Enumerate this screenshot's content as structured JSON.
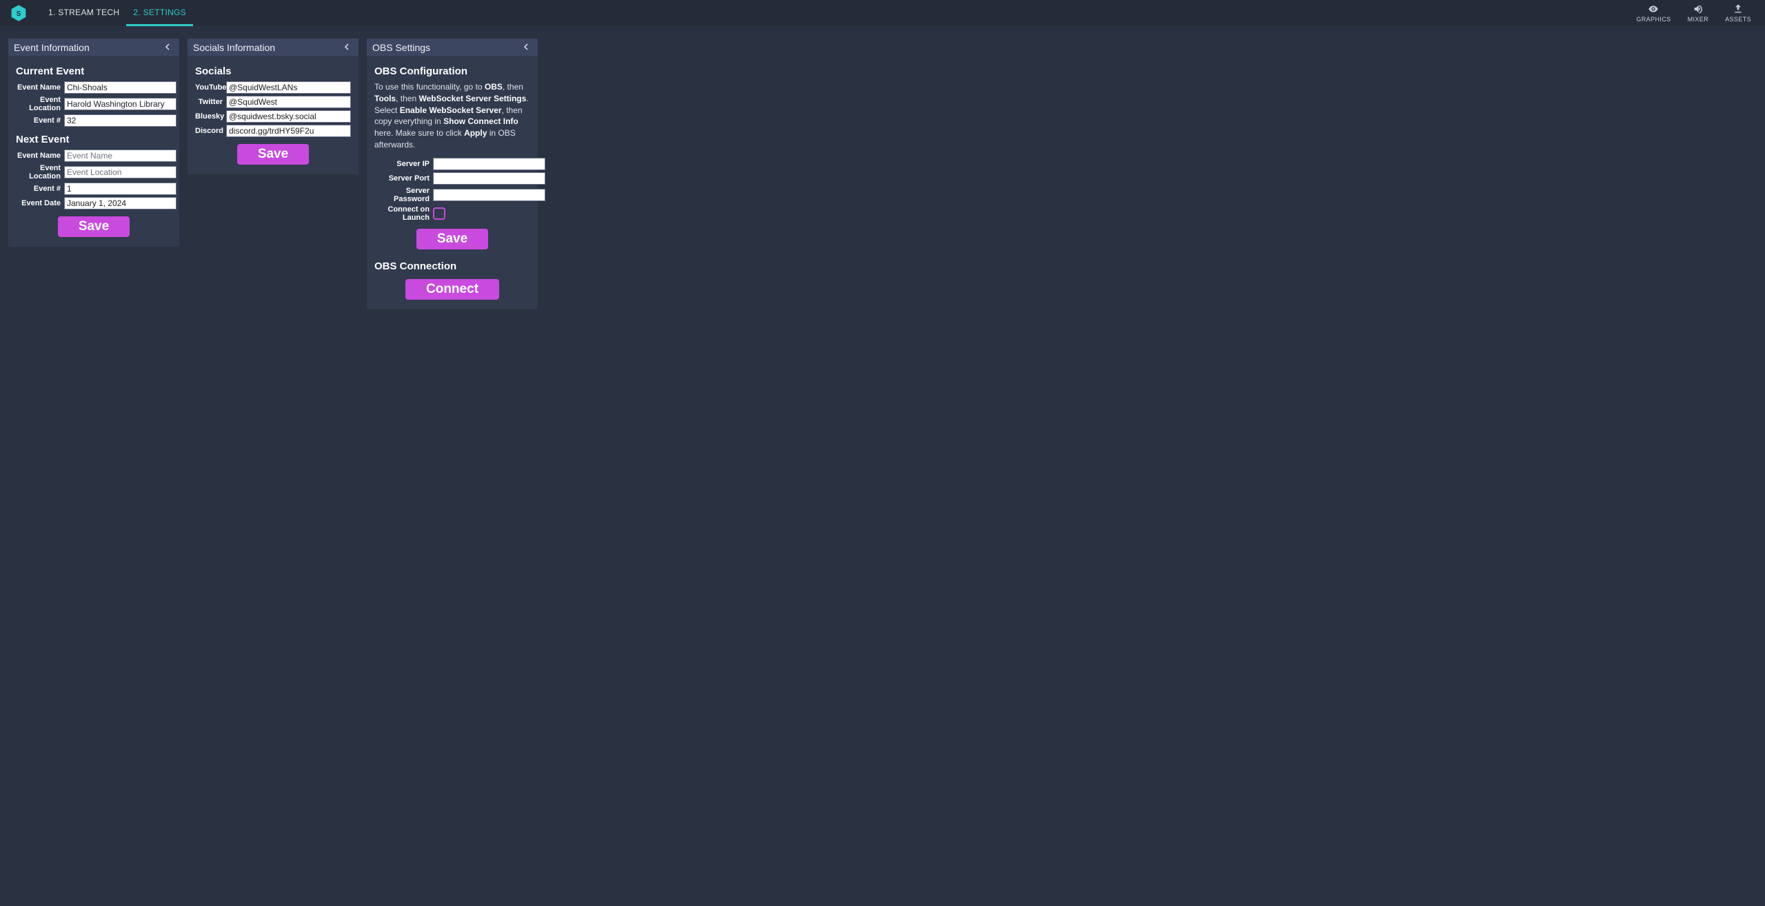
{
  "header": {
    "tabs": [
      {
        "label": "1. STREAM TECH",
        "active": false
      },
      {
        "label": "2. SETTINGS",
        "active": true
      }
    ],
    "right": {
      "graphics": "GRAPHICS",
      "mixer": "MIXER",
      "assets": "ASSETS"
    }
  },
  "panels": {
    "event": {
      "title": "Event Information",
      "current_heading": "Current Event",
      "next_heading": "Next Event",
      "labels": {
        "event_name": "Event Name",
        "event_location": "Event Location",
        "event_number": "Event #",
        "event_date": "Event Date"
      },
      "current": {
        "name": "Chi-Shoals",
        "location": "Harold Washington Library",
        "number": "32"
      },
      "next": {
        "name": "",
        "location": "",
        "number": "1",
        "date": "January 1, 2024",
        "name_placeholder": "Event Name",
        "location_placeholder": "Event Location"
      },
      "save_label": "Save"
    },
    "socials": {
      "title": "Socials Information",
      "heading": "Socials",
      "labels": {
        "youtube": "YouTube",
        "twitter": "Twitter",
        "bluesky": "Bluesky",
        "discord": "Discord"
      },
      "values": {
        "youtube": "@SquidWestLANs",
        "twitter": "@SquidWest",
        "bluesky": "@squidwest.bsky.social",
        "discord": "discord.gg/trdHY59F2u"
      },
      "save_label": "Save"
    },
    "obs": {
      "title": "OBS Settings",
      "config_heading": "OBS Configuration",
      "help": {
        "p1a": "To use this functionality, go to ",
        "b1": "OBS",
        "p1b": ", then ",
        "b2": "Tools",
        "p1c": ", then ",
        "b3": "WebSocket Server Settings",
        "p1d": ". Select ",
        "b4": "Enable WebSocket Server",
        "p1e": ", then copy everything in ",
        "b5": "Show Connect Info",
        "p1f": " here. Make sure to click ",
        "b6": "Apply",
        "p1g": " in OBS afterwards."
      },
      "labels": {
        "ip": "Server IP",
        "port": "Server Port",
        "password": "Server Password",
        "launch": "Connect on Launch"
      },
      "values": {
        "ip": "",
        "port": "",
        "password": "",
        "launch": false
      },
      "save_label": "Save",
      "connection_heading": "OBS Connection",
      "connect_label": "Connect"
    }
  }
}
